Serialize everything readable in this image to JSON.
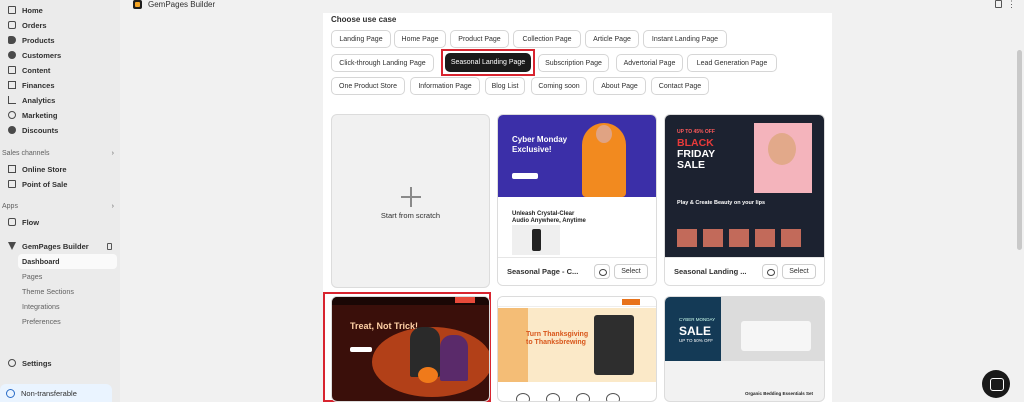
{
  "sidebar": {
    "nav": [
      {
        "label": "Home",
        "icon": "home-icon"
      },
      {
        "label": "Orders",
        "icon": "orders-icon"
      },
      {
        "label": "Products",
        "icon": "tag-icon"
      },
      {
        "label": "Customers",
        "icon": "person-icon"
      },
      {
        "label": "Content",
        "icon": "content-icon"
      },
      {
        "label": "Finances",
        "icon": "bank-icon"
      },
      {
        "label": "Analytics",
        "icon": "chart-icon"
      },
      {
        "label": "Marketing",
        "icon": "target-icon"
      },
      {
        "label": "Discounts",
        "icon": "discount-icon"
      }
    ],
    "sales_channels_label": "Sales channels",
    "sales_channels": [
      {
        "label": "Online Store",
        "icon": "store-icon"
      },
      {
        "label": "Point of Sale",
        "icon": "pos-icon"
      }
    ],
    "apps_label": "Apps",
    "apps": [
      {
        "label": "Flow",
        "icon": "flow-icon"
      },
      {
        "label": "GemPages Builder",
        "icon": "gempages-icon"
      }
    ],
    "gempages_sub": [
      "Dashboard",
      "Pages",
      "Theme Sections",
      "Integrations",
      "Preferences"
    ],
    "settings": "Settings",
    "non_transferable": "Non-transferable"
  },
  "appbar": {
    "title": "GemPages Builder"
  },
  "panel": {
    "heading": "Choose use case",
    "chips_row1": [
      "Landing Page",
      "Home Page",
      "Product Page",
      "Collection Page",
      "Article Page",
      "Instant Landing Page"
    ],
    "chips_row2": [
      "Click-through Landing Page",
      "Seasonal Landing Page",
      "Subscription Page",
      "Advertorial Page",
      "Lead Generation Page"
    ],
    "chips_row3": [
      "One Product Store",
      "Information Page",
      "Blog List",
      "Coming soon",
      "About Page",
      "Contact Page"
    ],
    "active_chip": "Seasonal Landing Page",
    "scratch_label": "Start from scratch",
    "cards": [
      {
        "name": "Seasonal Page - C...",
        "select": "Select",
        "hero": "Cyber Monday Exclusive!",
        "sub": "Unleash Crystal-Clear Audio Anywhere, Anytime"
      },
      {
        "name": "Seasonal Landing ...",
        "select": "Select",
        "promo": "UP TO 45% OFF",
        "hero_black": "BLACK",
        "hero_friday": "FRIDAY",
        "hero_sale": "SALE",
        "sub": "Play & Create Beauty on your lips"
      },
      {
        "hero": "Treat, Not Trick!"
      },
      {
        "hero": "Turn Thanksgiving to Thanksbrewing"
      },
      {
        "small": "CYBER MONDAY",
        "hero": "SALE",
        "off": "UP TO 50% OFF",
        "label": "Organic Bedding Essentials Set"
      }
    ]
  },
  "colors": {
    "highlight_red": "#d8242f",
    "active_chip_bg": "#1a1a1a"
  }
}
